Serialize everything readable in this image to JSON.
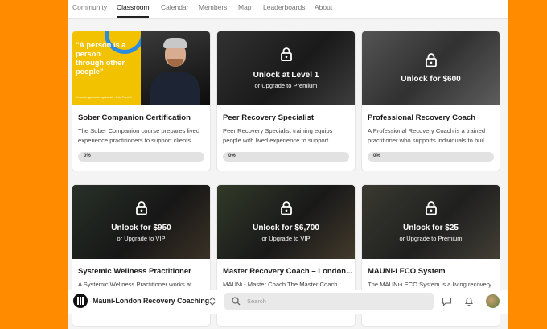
{
  "nav": {
    "tabs": [
      "Community",
      "Classroom",
      "Calendar",
      "Members",
      "Map",
      "Leaderboards",
      "About"
    ],
    "active": "Classroom"
  },
  "courses": [
    {
      "title": "Sober Companion Certification",
      "description": "The Sober Companion course prepares lived experience practitioners to support clients...",
      "progress": "0%",
      "quote": "\"A person is a person through other people\"",
      "quote_attribution": "\"Umuntu ngumuntu ngabantu\" - Zulu Proverb"
    },
    {
      "title": "Peer Recovery Specialist",
      "description": "Peer Recovery Specialist training equips people with lived experience to support...",
      "progress": "0%",
      "unlock": "Unlock at Level 1",
      "upgrade": "or Upgrade to Premium"
    },
    {
      "title": "Professional Recovery Coach",
      "description": "A Professional Recovery Coach is a trained practitioner who supports individuals to buil...",
      "progress": "0%",
      "unlock": "Unlock for $600"
    },
    {
      "title": "Systemic Wellness Practitioner",
      "description": "A Systemic Wellness Practitioner works at",
      "unlock": "Unlock for $950",
      "upgrade": "or Upgrade to VIP"
    },
    {
      "title": "Master Recovery Coach – London...",
      "description": "MAUNi - Master Coach The Master Coach",
      "unlock": "Unlock for $6,700",
      "upgrade": "or Upgrade to VIP"
    },
    {
      "title": "MAUNi-i ECO System",
      "description": "The MAUNi-i ECO System is a living recovery",
      "unlock": "Unlock for $25",
      "upgrade": "or Upgrade to Premium"
    }
  ],
  "bottom": {
    "group_name": "Mauni-London Recovery Coaching",
    "search_placeholder": "Search"
  },
  "colors": {
    "background": "#ff8c00",
    "quote_card": "#f2c200",
    "quote_accent": "#2b8be0"
  },
  "icons": [
    "lock-icon",
    "search-icon",
    "chevron-updown-icon",
    "chat-icon",
    "bell-icon",
    "avatar"
  ]
}
